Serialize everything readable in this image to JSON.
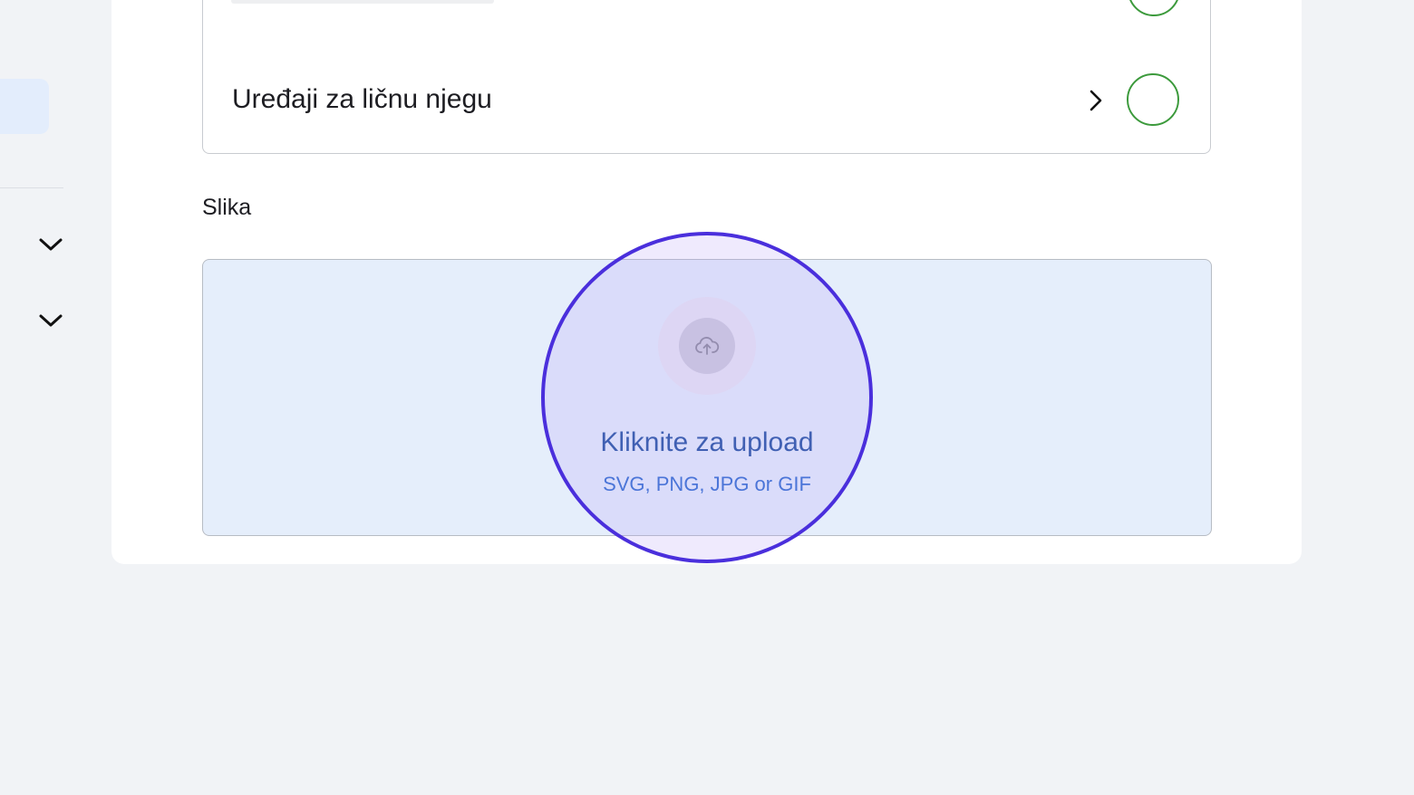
{
  "category_list": {
    "rows": [
      {
        "label": "Uređaji za ličnu njegu"
      }
    ]
  },
  "image_section": {
    "label": "Slika",
    "upload": {
      "title": "Kliknite za upload",
      "hint": "SVG, PNG, JPG or GIF",
      "icon": "cloud-upload-icon"
    }
  },
  "icons": {
    "sidebar": [
      "chevron-down-icon",
      "chevron-down-icon"
    ],
    "row": "chevron-right-icon",
    "radio": "radio-button"
  },
  "colors": {
    "radio_border": "#3c9a3c",
    "upload_bg": "#e5eefb",
    "upload_title": "#1f4fa0",
    "upload_hint": "#2d6ad0",
    "highlight_ring": "#4a2fdc"
  }
}
